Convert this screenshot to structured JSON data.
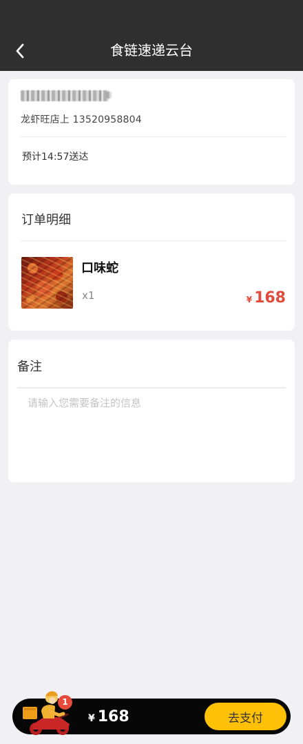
{
  "header": {
    "title": "食链速递云台",
    "back_icon": "chevron-left-icon"
  },
  "delivery": {
    "address_contact": "龙虾旺店上 13520958804",
    "estimated_time": "预计14:57送达"
  },
  "order": {
    "title": "订单明细",
    "items": [
      {
        "name": "口味蛇",
        "quantity": "x1",
        "currency": "¥",
        "price": "168"
      }
    ]
  },
  "remark": {
    "title": "备注",
    "placeholder": "请输入您需要备注的信息"
  },
  "checkout": {
    "badge_count": "1",
    "currency": "¥",
    "total": "168",
    "pay_label": "去支付",
    "courier_icon": "delivery-courier-icon"
  },
  "colors": {
    "header_bg": "#2f2f2f",
    "page_bg": "#f1f1f5",
    "price_red": "#e14b3c",
    "pay_yellow": "#ffc107",
    "bar_black": "#070707"
  }
}
